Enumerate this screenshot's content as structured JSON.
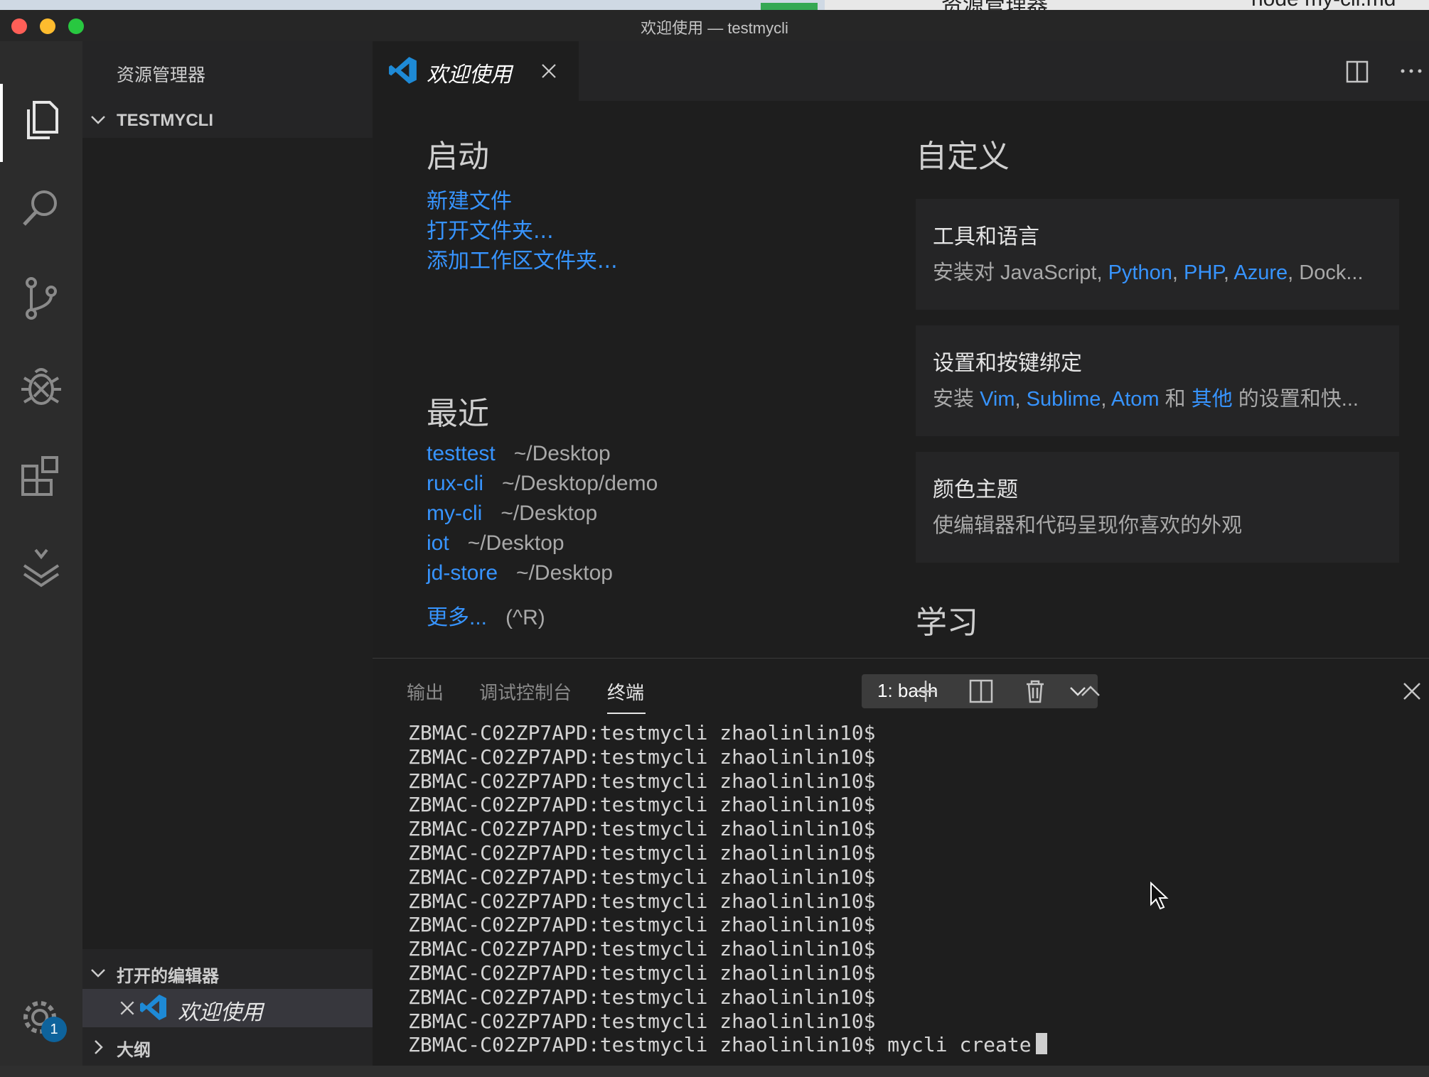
{
  "background_window": {
    "text_left": "资源管理器",
    "text_right": "node my-cli.md"
  },
  "window": {
    "title": "欢迎使用 — testmycli",
    "traffic_lights": {
      "close": "#ff5f57",
      "minimize": "#febc2e",
      "maximize": "#28c840"
    }
  },
  "activity_bar": {
    "items": [
      "explorer-icon",
      "search-icon",
      "source-control-icon",
      "debug-icon",
      "extensions-icon",
      "layers-icon"
    ],
    "settings_badge": "1"
  },
  "sidebar": {
    "header": "资源管理器",
    "folder": "TESTMYCLI",
    "open_editors_title": "打开的编辑器",
    "open_editors": [
      {
        "label": "欢迎使用"
      }
    ],
    "outline_title": "大纲"
  },
  "tabs": [
    {
      "label": "欢迎使用",
      "active": true
    }
  ],
  "welcome": {
    "start": {
      "title": "启动",
      "links": [
        "新建文件",
        "打开文件夹...",
        "添加工作区文件夹..."
      ]
    },
    "recent": {
      "title": "最近",
      "items": [
        {
          "name": "testtest",
          "path": "~/Desktop"
        },
        {
          "name": "rux-cli",
          "path": "~/Desktop/demo"
        },
        {
          "name": "my-cli",
          "path": "~/Desktop"
        },
        {
          "name": "iot",
          "path": "~/Desktop"
        },
        {
          "name": "jd-store",
          "path": "~/Desktop"
        }
      ],
      "more_label": "更多...",
      "more_shortcut": "(^R)"
    },
    "customize": {
      "title": "自定义",
      "cards": [
        {
          "title": "工具和语言",
          "desc_prefix": "安装对 JavaScript, ",
          "hl1": "Python",
          "sep1": ", ",
          "hl2": "PHP",
          "sep2": ", ",
          "hl3": "Azure",
          "desc_suffix": ", Dock..."
        },
        {
          "title": "设置和按键绑定",
          "desc_prefix": "安装 ",
          "hl1": "Vim",
          "sep1": ", ",
          "hl2": "Sublime",
          "sep2": ", ",
          "hl3": "Atom",
          "sep3": " 和 ",
          "hl4": "其他",
          "desc_suffix": " 的设置和快..."
        },
        {
          "title": "颜色主题",
          "desc": "使编辑器和代码呈现你喜欢的外观"
        }
      ]
    },
    "learn": {
      "title": "学习"
    }
  },
  "panel": {
    "tabs": [
      "输出",
      "调试控制台",
      "终端"
    ],
    "active_tab": "终端",
    "terminal_select": "1: bash",
    "prompt": "ZBMAC-C02ZP7APD:testmycli zhaolinlin10$",
    "prompt_repeat_count": 13,
    "last_command": "mycli create"
  },
  "colors": {
    "accent_link": "#3794ff",
    "badge": "#0e639c"
  }
}
